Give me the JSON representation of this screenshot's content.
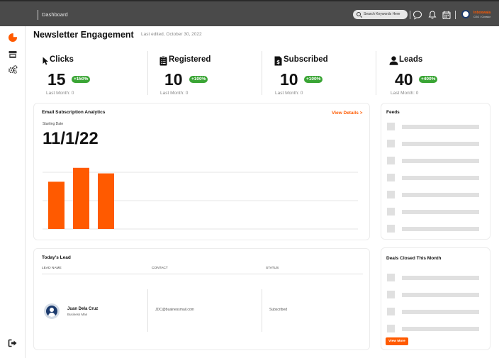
{
  "topbar": {
    "breadcrumb": "Dashboard",
    "search_placeholder": "Search Keywords Here",
    "user_name": "Inboxwala",
    "user_role": "CEO / Creator"
  },
  "page": {
    "title": "Newsletter Engagement",
    "last_edited": "Last edited, October 30, 2022"
  },
  "stats": [
    {
      "label": "Clicks",
      "value": "15",
      "change": "+150%",
      "last_month": "Last Month: 0"
    },
    {
      "label": "Registered",
      "value": "10",
      "change": "+100%",
      "last_month": "Last Month: 0"
    },
    {
      "label": "Subscribed",
      "value": "10",
      "change": "+100%",
      "last_month": "Last Month: 0"
    },
    {
      "label": "Leads",
      "value": "40",
      "change": "+400%",
      "last_month": "Last Month: 0"
    }
  ],
  "analytics": {
    "title": "Email Subscription Analytics",
    "view_details": "View Details >",
    "starting_label": "Starting Date",
    "starting_date": "11/1/22"
  },
  "chart_data": {
    "type": "bar",
    "categories": [
      "",
      "",
      ""
    ],
    "values": [
      68,
      88,
      80
    ],
    "ylim": [
      0,
      100
    ],
    "grid": true,
    "color": "#ff5a00"
  },
  "feeds": {
    "title": "Feeds",
    "rows": 7
  },
  "deals": {
    "title": "Deals Closed This Month",
    "rows": 4,
    "view_more": "View More"
  },
  "leads": {
    "title": "Today's Lead",
    "columns": [
      "LEAD NAME",
      "CONTACT",
      "STATUS"
    ],
    "rows": [
      {
        "name": "Juan Dela Cruz",
        "role": "Business Man",
        "contact": "JDC@buainessmail.com",
        "status": "Subscribed"
      }
    ]
  },
  "colors": {
    "accent": "#ff5a00",
    "badge": "#3aa535",
    "topbar": "#4a4a4a"
  }
}
